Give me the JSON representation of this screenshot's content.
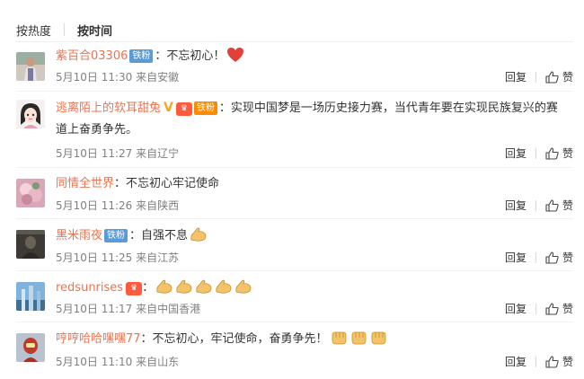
{
  "sort": {
    "hot": "按热度",
    "time": "按时间"
  },
  "labels": {
    "iron_fan": "铁粉",
    "reply": "回复",
    "like": "赞"
  },
  "colors": {
    "username": "#eb7350",
    "meta": "#808080",
    "iron_badge": "#5b9bd5",
    "fans_badge": "#ff8a00"
  },
  "comments": [
    {
      "user": "紫百合03306",
      "badge": "iron",
      "text": "：不忘初心！",
      "emoji": [
        "heart"
      ],
      "time": "5月10日 11:30",
      "location": "来自安徽",
      "avatar": "person-photo-avatar"
    },
    {
      "user": "逃离陌上的软耳甜兔",
      "badge": "v-fans",
      "text": "：实现中国梦是一场历史接力赛，当代青年要在实现民族复兴的赛道上奋勇争先。",
      "emoji": [],
      "time": "5月10日 11:27",
      "location": "来自辽宁",
      "avatar": "cartoon-girl-avatar"
    },
    {
      "user": "同情全世界",
      "badge": "",
      "text": "：不忘初心牢记使命",
      "emoji": [],
      "time": "5月10日 11:26",
      "location": "来自陕西",
      "avatar": "flower-avatar"
    },
    {
      "user": "黑米雨夜",
      "badge": "iron",
      "text": "：自强不息",
      "emoji": [
        "muscle"
      ],
      "time": "5月10日 11:25",
      "location": "来自江苏",
      "avatar": "dark-portrait-avatar"
    },
    {
      "user": "redsunrises",
      "badge": "svip",
      "text": "：",
      "emoji": [
        "muscle",
        "muscle",
        "muscle",
        "muscle",
        "muscle"
      ],
      "time": "5月10日 11:17",
      "location": "来自中国香港",
      "avatar": "blue-sky-avatar"
    },
    {
      "user": "哼哼哈哈嘿嘿77",
      "badge": "",
      "text": "：不忘初心，牢记使命，奋勇争先！",
      "emoji": [
        "fist",
        "fist",
        "fist"
      ],
      "time": "5月10日 11:10",
      "location": "来自山东",
      "avatar": "hero-avatar"
    }
  ]
}
